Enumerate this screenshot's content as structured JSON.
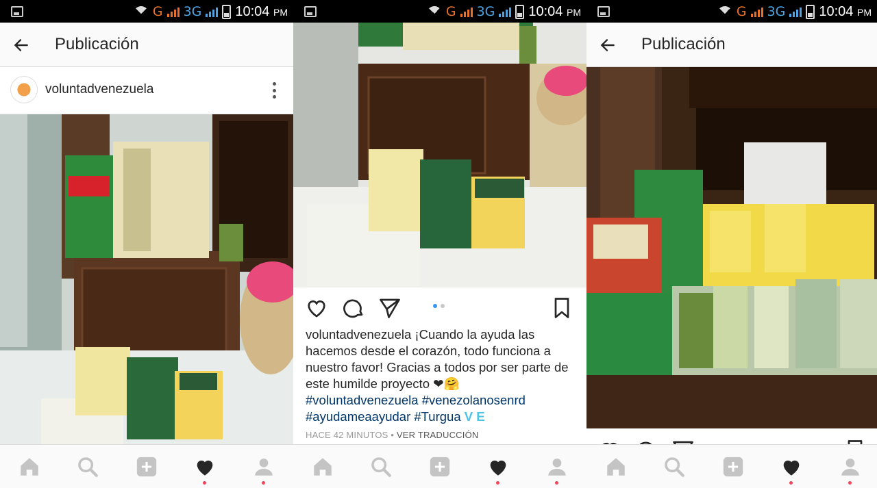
{
  "status_bar": {
    "network_letter": "G",
    "network_type": "3G",
    "time": "10:04",
    "ampm": "PM"
  },
  "header": {
    "title": "Publicación"
  },
  "post": {
    "username": "voluntadvenezuela",
    "caption_user": "voluntadvenezuela",
    "caption_text": " ¡Cuando la ayuda las hacemos desde el corazón, todo funciona a nuestro favor! Gracias a todos por ser parte de este humilde proyecto ❤🤗",
    "hashtags": [
      "#voluntadvenezuela",
      "#venezolanosenrd",
      "#ayudameaayudar",
      "#Turgua"
    ],
    "flag_text": "V E",
    "time_ago": "HACE 42 MINUTOS",
    "separator": "•",
    "translate": "VER TRADUCCIÓN"
  },
  "icons": {
    "back": "arrow-left-icon",
    "more": "more-vertical-icon",
    "like": "heart-outline-icon",
    "comment": "comment-icon",
    "share": "send-icon",
    "save": "bookmark-icon",
    "home": "home-icon",
    "search": "search-icon",
    "add": "add-icon",
    "activity": "heart-filled-icon",
    "profile": "profile-icon"
  },
  "colors": {
    "accent_blue": "#3897f0",
    "hashtag": "#003569",
    "notification_dot": "#f0465a"
  }
}
